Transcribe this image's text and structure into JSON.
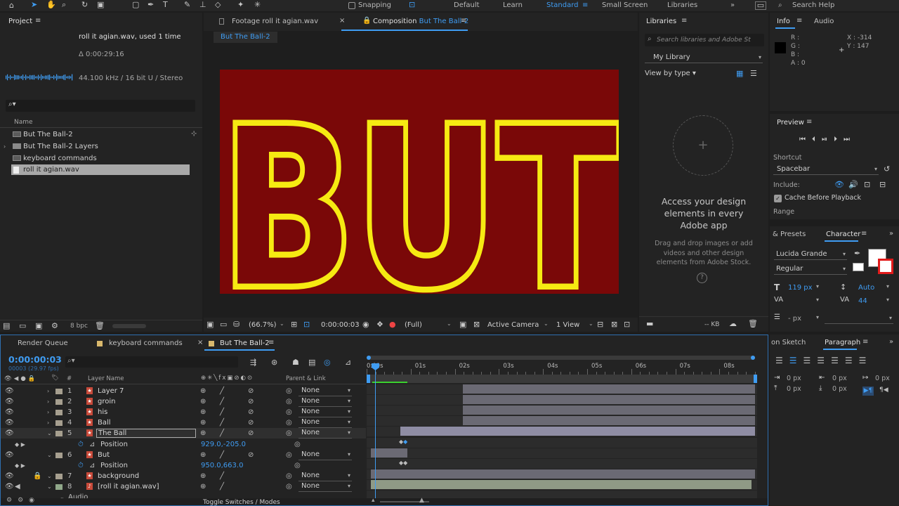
{
  "workspace": {
    "items": [
      "Default",
      "Learn",
      "Standard",
      "Small Screen",
      "Libraries"
    ],
    "snapping_label": "Snapping",
    "search_placeholder": "Search Help"
  },
  "project": {
    "title": "Project",
    "file_name": "roll it agian.wav",
    "used": ", used 1 time",
    "duration": "Δ 0:00:29:16",
    "audio_info": "44.100 kHz / 16 bit U / Stereo",
    "column_name": "Name",
    "items": [
      {
        "name": "But The Ball-2",
        "kind": "comp"
      },
      {
        "name": "But The Ball-2 Layers",
        "kind": "folder"
      },
      {
        "name": "keyboard commands",
        "kind": "comp"
      },
      {
        "name": "roll it agian.wav",
        "kind": "audio"
      }
    ],
    "bpc": "8 bpc"
  },
  "viewer": {
    "tab_footage": "Footage roll it agian.wav",
    "tab_comp_prefix": "Composition",
    "tab_comp_name": "But The Ball-2",
    "breadcrumb": "But The Ball-2",
    "canvas_text": "BUT",
    "canvas_bg": "#7a0808",
    "text_color": "#f6ea12",
    "zoom": "(66.7%)",
    "timecode": "0:00:00:03",
    "resolution": "(Full)",
    "camera": "Active Camera",
    "views": "1 View"
  },
  "libraries": {
    "title": "Libraries",
    "search_placeholder": "Search libraries and Adobe St",
    "library": "My Library",
    "view_by": "View by type",
    "headline": "Access your design elements in every Adobe app",
    "body": "Drag and drop images or add videos and other design elements from Adobe Stock.",
    "footer_kb": "-- KB"
  },
  "info": {
    "tab_info": "Info",
    "tab_audio": "Audio",
    "r": "R :",
    "g": "G :",
    "b": "B :",
    "a": "A : 0",
    "x": "X : -314",
    "y": "Y : 147"
  },
  "preview": {
    "title": "Preview",
    "shortcut_label": "Shortcut",
    "shortcut_value": "Spacebar",
    "include_label": "Include:",
    "cache_label": "Cache Before Playback",
    "range_label": "Range"
  },
  "character": {
    "presets_tab": "& Presets",
    "title": "Character",
    "font": "Lucida Grande",
    "style": "Regular",
    "size": "119 px",
    "leading": "Auto",
    "tracking": "44",
    "px_field": "- px"
  },
  "paragraph": {
    "sketch_tab": "on Sketch",
    "title": "Paragraph",
    "values": [
      "0 px",
      "0 px",
      "0 px",
      "0 px",
      "0 px"
    ]
  },
  "timeline": {
    "tabs": [
      "Render Queue",
      "keyboard commands",
      "But The Ball-2"
    ],
    "timecode": "0:00:00:03",
    "timecode_sub": "00003 (29.97 fps)",
    "col_num": "#",
    "col_layer": "Layer Name",
    "col_parent": "Parent & Link",
    "ruler": [
      "0:00s",
      "01s",
      "02s",
      "03s",
      "04s",
      "05s",
      "06s",
      "07s",
      "08s"
    ],
    "layers": [
      {
        "num": "1",
        "name": "Layer 7",
        "parent": "None",
        "color": "#a69f8f",
        "sub": false
      },
      {
        "num": "2",
        "name": "groin",
        "parent": "None",
        "color": "#a69f8f",
        "sub": false
      },
      {
        "num": "3",
        "name": "his",
        "parent": "None",
        "color": "#a69f8f",
        "sub": false
      },
      {
        "num": "4",
        "name": "Ball",
        "parent": "None",
        "color": "#a69f8f",
        "sub": false
      },
      {
        "num": "5",
        "name": "The Ball",
        "parent": "None",
        "color": "#a69f8f",
        "sub": false,
        "selected": true
      },
      {
        "name": "Position",
        "value": "929.0,-205.0",
        "sub": true
      },
      {
        "num": "6",
        "name": "But",
        "parent": "None",
        "color": "#a69f8f",
        "sub": false
      },
      {
        "name": "Position",
        "value": "950.0,663.0",
        "sub": true
      },
      {
        "num": "7",
        "name": "background",
        "parent": "None",
        "color": "#a69f8f",
        "sub": false
      },
      {
        "num": "8",
        "name": "[roll it agian.wav]",
        "parent": "None",
        "color": "#90a88a",
        "sub": false
      },
      {
        "name": "Audio",
        "sub": true
      }
    ],
    "toggle_label": "Toggle Switches / Modes"
  }
}
